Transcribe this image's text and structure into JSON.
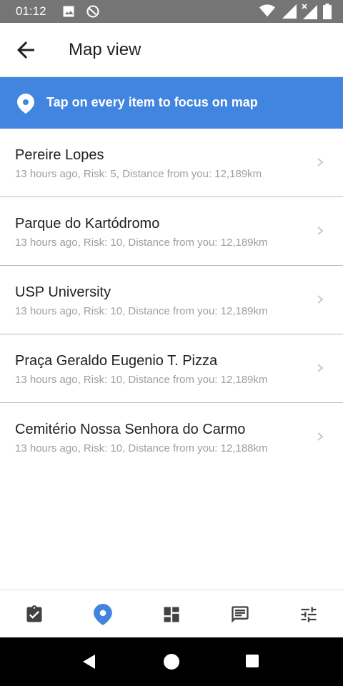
{
  "status_bar": {
    "time": "01:12",
    "icons": [
      "image-icon",
      "do-not-disturb-icon",
      "wifi-icon",
      "signal-icon",
      "signal-no-data-icon",
      "battery-icon"
    ]
  },
  "header": {
    "title": "Map view",
    "back_icon": "arrow-back-icon"
  },
  "banner": {
    "text": "Tap on every item to focus on map",
    "icon": "location-pin-icon",
    "color": "#4285e0"
  },
  "list": {
    "items": [
      {
        "title": "Pereire Lopes",
        "subtitle": "13 hours ago, Risk: 5, Distance from you: 12,189km"
      },
      {
        "title": "Parque do Kartódromo",
        "subtitle": "13 hours ago, Risk: 10, Distance from you: 12,189km"
      },
      {
        "title": "USP University",
        "subtitle": "13 hours ago, Risk: 10, Distance from you: 12,189km"
      },
      {
        "title": "Praça Geraldo Eugenio T. Pizza",
        "subtitle": "13 hours ago, Risk: 10, Distance from you: 12,189km"
      },
      {
        "title": "Cemitério Nossa Senhora do Carmo",
        "subtitle": "13 hours ago, Risk: 10, Distance from you: 12,188km"
      }
    ]
  },
  "bottom_nav": {
    "items": [
      "checklist-icon",
      "location-pin-icon",
      "dashboard-icon",
      "chat-icon",
      "tune-icon"
    ],
    "active_index": 1,
    "active_color": "#4285e0",
    "inactive_color": "#424242"
  },
  "system_nav": {
    "buttons": [
      "back-triangle-icon",
      "home-circle-icon",
      "recents-square-icon"
    ]
  }
}
